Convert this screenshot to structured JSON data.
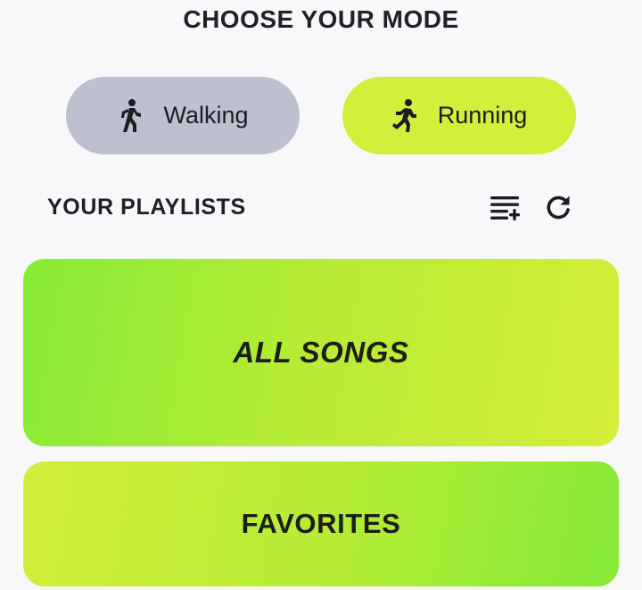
{
  "header": {
    "title": "CHOOSE YOUR MODE"
  },
  "modes": [
    {
      "label": "Walking",
      "icon": "walking-person-icon",
      "color": "#bfc0cf"
    },
    {
      "label": "Running",
      "icon": "running-person-icon",
      "color": "#d3ef3c",
      "selected": true
    }
  ],
  "playlists_section": {
    "title": "YOUR PLAYLISTS",
    "actions": [
      {
        "icon": "playlist-add-icon"
      },
      {
        "icon": "refresh-icon"
      }
    ]
  },
  "playlists": [
    {
      "label": "ALL SONGS"
    },
    {
      "label": "FAVORITES"
    }
  ],
  "colors": {
    "accent_lime": "#d3ef3c",
    "accent_green": "#86eb36",
    "inactive_gray": "#bfc0cf",
    "background": "#f8f8fb"
  }
}
